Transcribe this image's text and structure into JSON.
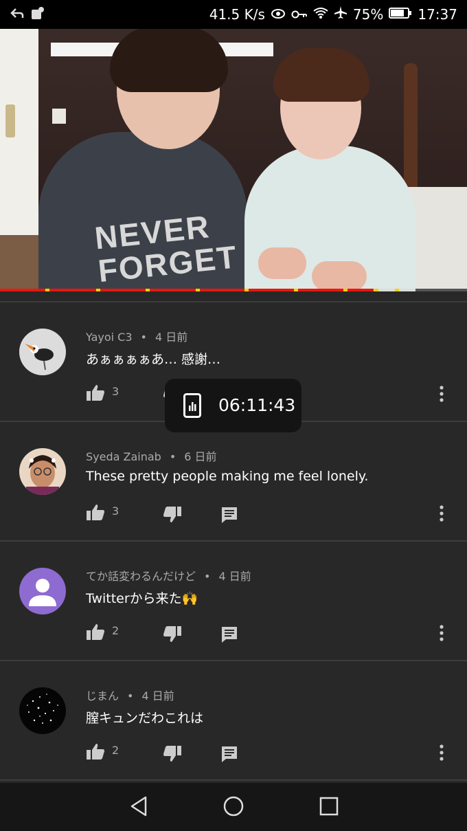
{
  "status_bar": {
    "speed": "41.5 K/s",
    "battery": "75%",
    "time": "17:37"
  },
  "video": {
    "shirt_text": "NEVER FORGET",
    "progress_fraction": 0.8,
    "buffer_fraction": 0.89
  },
  "comments": [
    {
      "author": "Yayoi C3",
      "age": "4 日前",
      "text": "あぁぁぁぁあ… 感謝…",
      "likes": "3",
      "avatar": "toucan-avatar"
    },
    {
      "author": "Syeda Zainab",
      "age": "6 日前",
      "text": "These pretty people making me feel lonely.",
      "likes": "3",
      "avatar": "girl-photo-avatar"
    },
    {
      "author": "てか話変わるんだけど",
      "age": "4 日前",
      "text": "Twitterから来た🙌",
      "likes": "2",
      "avatar": "default-person-avatar"
    },
    {
      "author": "じまん",
      "age": "4 日前",
      "text": "膣キュンだわこれは",
      "likes": "2",
      "avatar": "starry-avatar"
    }
  ],
  "separator": "•",
  "toast": {
    "time": "06:11:43",
    "icon": "phone-usage-icon"
  },
  "colors": {
    "background": "#282828",
    "progress": "#e8170f",
    "ad_marker": "#f5d100",
    "default_avatar": "#8e6bd0"
  }
}
